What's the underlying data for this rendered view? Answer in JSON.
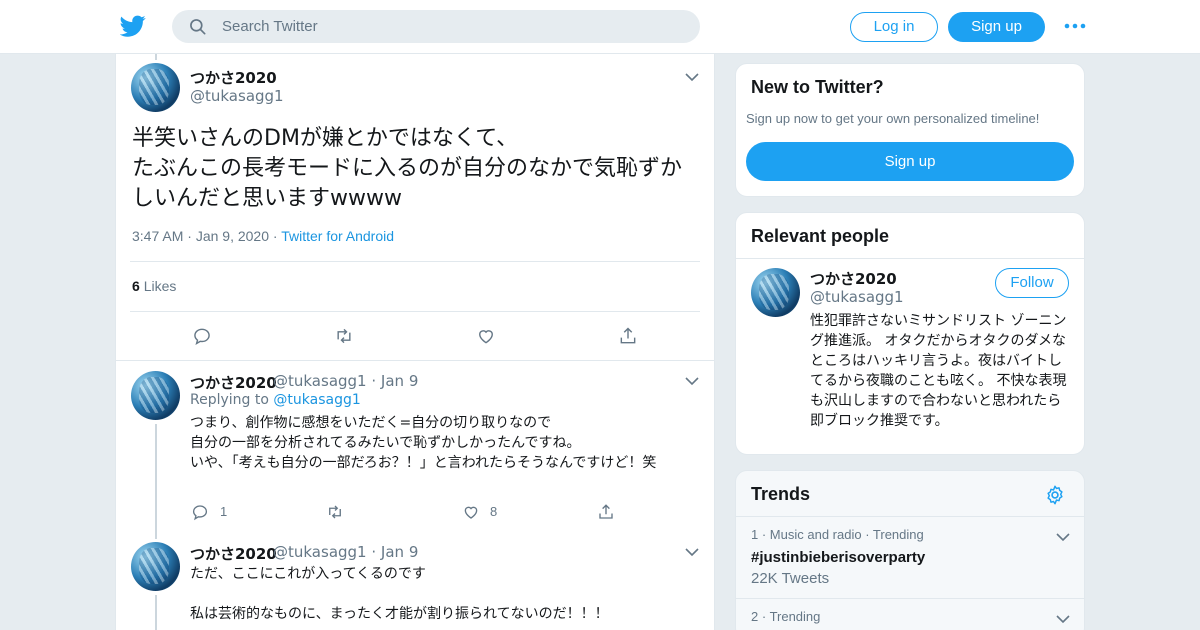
{
  "header": {
    "search_placeholder": "Search Twitter",
    "login_label": "Log in",
    "signup_label": "Sign up",
    "brand_color": "#1da1f2"
  },
  "main_tweet": {
    "name": "つかさ2020",
    "handle": "@tukasagg1",
    "text": "半笑いさんのDMが嫌とかではなくて、\nたぶんこの長考モードに入るのが自分のなかで気恥ずかしいんだと思いますwwww",
    "time": "3:47 AM",
    "date": "Jan 9, 2020",
    "source": "Twitter for Android",
    "likes_count": "6",
    "likes_label": "Likes"
  },
  "replies": [
    {
      "name": "つかさ2020",
      "handle": "@tukasagg1",
      "date": "Jan 9",
      "replying_label": "Replying to",
      "replying_handle": "@tukasagg1",
      "text": "つまり、創作物に感想をいただく=自分の切り取りなので\n自分の一部を分析されてるみたいで恥ずかしかったんですね。\nいや、「考えも自分の一部だろお？！」と言われたらそうなんですけど！笑",
      "reply_count": "1",
      "retweet_count": "",
      "like_count": "8"
    },
    {
      "name": "つかさ2020",
      "handle": "@tukasagg1",
      "date": "Jan 9",
      "text": "ただ、ここにこれが入ってくるのです\n\n私は芸術的なものに、まったく才能が割り振られてないのだ！！！"
    }
  ],
  "sidebar": {
    "new_card": {
      "title": "New to Twitter?",
      "subtitle": "Sign up now to get your own personalized timeline!",
      "button": "Sign up"
    },
    "relevant": {
      "title": "Relevant people",
      "name": "つかさ2020",
      "handle": "@tukasagg1",
      "follow_label": "Follow",
      "bio": "性犯罪許さないミサンドリスト ゾーニング推進派。 オタクだからオタクのダメなところはハッキリ言うよ。夜はバイトしてるから夜職のことも呟く。 不快な表現も沢山しますので合わないと思われたら即ブロック推奨です。"
    },
    "trends": {
      "title": "Trends",
      "items": [
        {
          "rank": "1",
          "category": "Music and radio",
          "status": "Trending",
          "name": "#justinbieberisoverparty",
          "count": "22K Tweets"
        },
        {
          "rank": "2",
          "category": "",
          "status": "Trending",
          "name": "",
          "count": ""
        }
      ]
    }
  }
}
